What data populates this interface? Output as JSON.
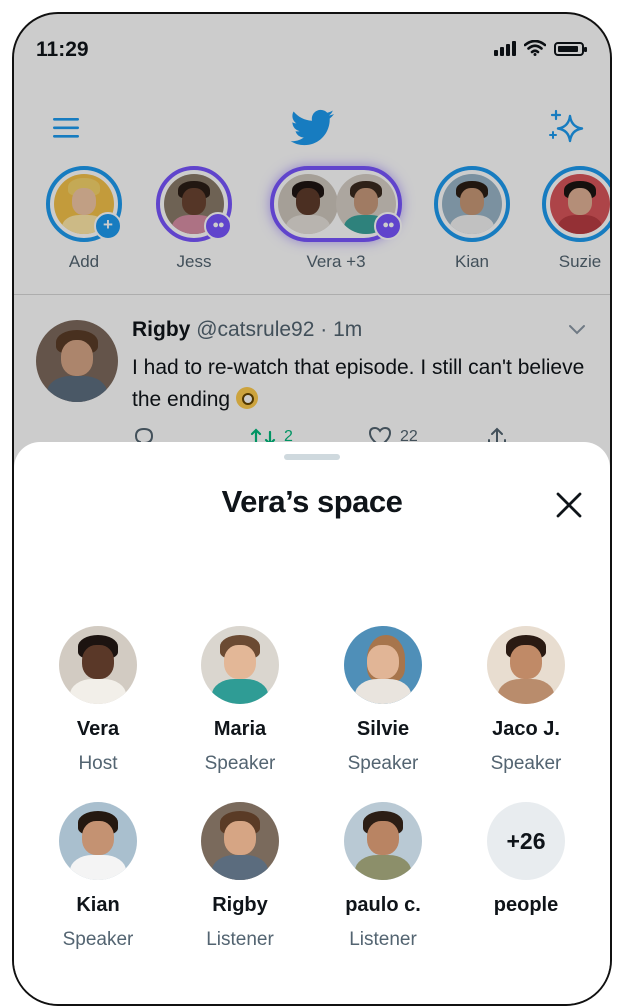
{
  "status_bar": {
    "time": "11:29",
    "battery_level": 0.9
  },
  "colors": {
    "accent": "#1d9bf0",
    "space": "#7856ff",
    "muted": "#536471"
  },
  "nav": {
    "left_icon": "menu-icon",
    "center_icon": "bird-logo-icon",
    "right_icon": "sparkle-icon"
  },
  "fleets": [
    {
      "label": "Add",
      "badge": "+"
    },
    {
      "label": "Jess"
    },
    {
      "label": "Vera +3"
    },
    {
      "label": "Kian"
    },
    {
      "label": "Suzie"
    }
  ],
  "tweet": {
    "name": "Rigby",
    "handle": "@catsrule92",
    "separator": "·",
    "time": "1m",
    "text": "I had to re-watch that episode. I still can't believe the ending",
    "retweets": "2",
    "likes": "22"
  },
  "sheet": {
    "title": "Vera’s space",
    "participants": [
      {
        "name": "Vera",
        "role": "Host"
      },
      {
        "name": "Maria",
        "role": "Speaker"
      },
      {
        "name": "Silvie",
        "role": "Speaker"
      },
      {
        "name": "Jaco J.",
        "role": "Speaker"
      },
      {
        "name": "Kian",
        "role": "Speaker"
      },
      {
        "name": "Rigby",
        "role": "Listener"
      },
      {
        "name": "paulo c.",
        "role": "Listener"
      }
    ],
    "more": {
      "count": "+26",
      "label": "people"
    }
  }
}
